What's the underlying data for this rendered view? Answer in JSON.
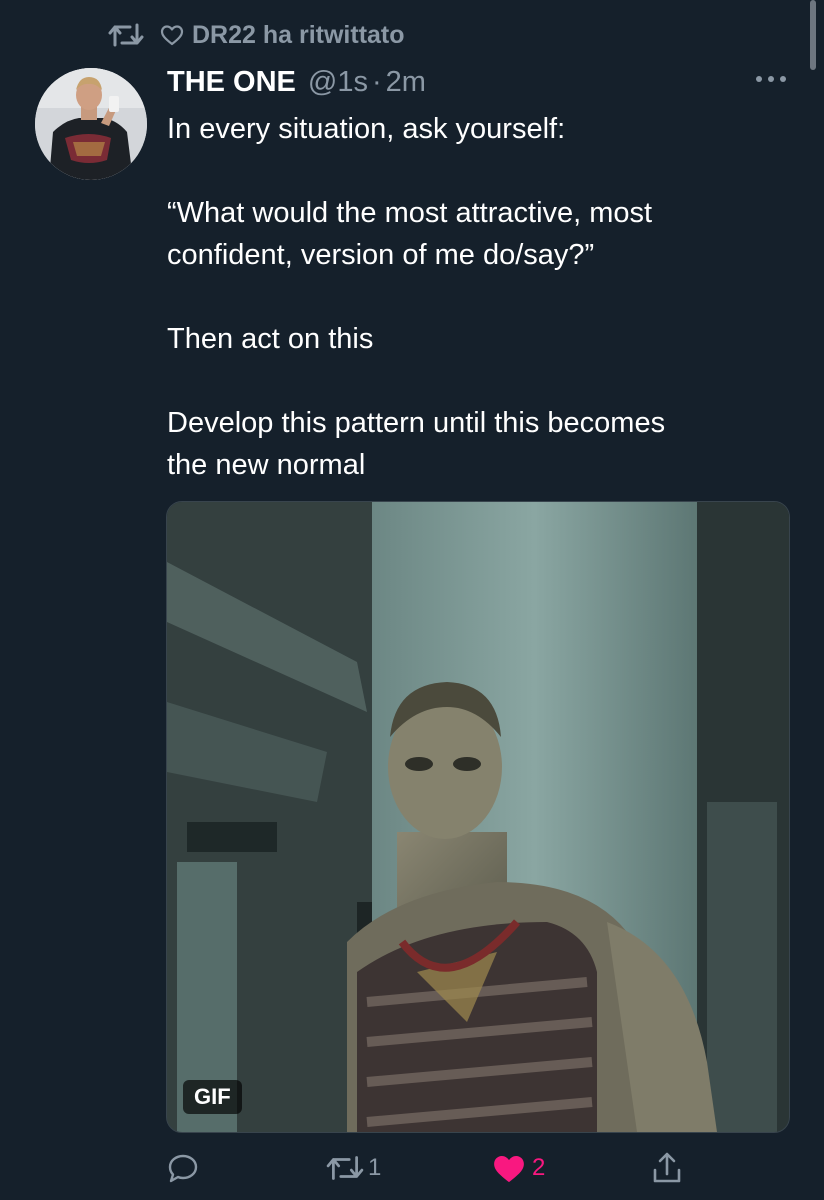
{
  "retweet_context": {
    "text": "DR22 ha ritwittato"
  },
  "tweet": {
    "author_name": "THE ONE",
    "author_handle": "@1s",
    "separator": "·",
    "time": "2m",
    "lines": [
      "In every situation, ask yourself:",
      "",
      "“What would the most attractive, most",
      "confident, version of me do/say?”",
      "",
      "Then act on this",
      "",
      "Develop this pattern until this becomes",
      "the new normal"
    ],
    "media": {
      "badge": "GIF"
    }
  },
  "actions": {
    "reply_count": "",
    "retweet_count": "1",
    "like_count": "2",
    "liked": true
  },
  "colors": {
    "background": "#15202b",
    "secondary_text": "#8b98a5",
    "like_active": "#f91880"
  },
  "icons": {
    "retweet_context": "retweet-icon",
    "like_context": "heart-outline-icon",
    "more": "more-options-icon",
    "reply": "reply-icon",
    "retweet": "retweet-icon",
    "like": "heart-filled-icon",
    "share": "share-icon"
  }
}
